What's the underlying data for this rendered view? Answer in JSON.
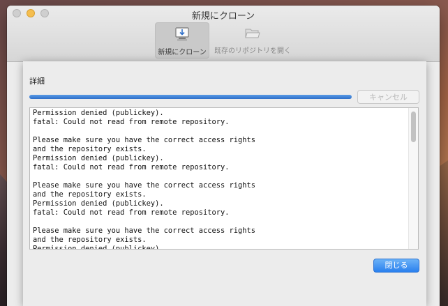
{
  "window": {
    "title": "新規にクローン",
    "toolbar": [
      {
        "label": "新規にクローン",
        "icon": "download-to-computer-icon",
        "active": true
      },
      {
        "label": "既存のリポジトリを開く",
        "icon": "folder-open-icon",
        "active": false
      }
    ]
  },
  "sheet": {
    "detail_label": "詳細",
    "progress_fraction": 1.0,
    "cancel_label": "キャンセル",
    "close_label": "閉じる",
    "log_text": "Permission denied (publickey).\nfatal: Could not read from remote repository.\n\nPlease make sure you have the correct access rights\nand the repository exists.\nPermission denied (publickey).\nfatal: Could not read from remote repository.\n\nPlease make sure you have the correct access rights\nand the repository exists.\nPermission denied (publickey).\nfatal: Could not read from remote repository.\n\nPlease make sure you have the correct access rights\nand the repository exists.\nPermission denied (publickey)."
  },
  "colors": {
    "accent": "#2a80ee",
    "progress": "#3d7fd6"
  }
}
